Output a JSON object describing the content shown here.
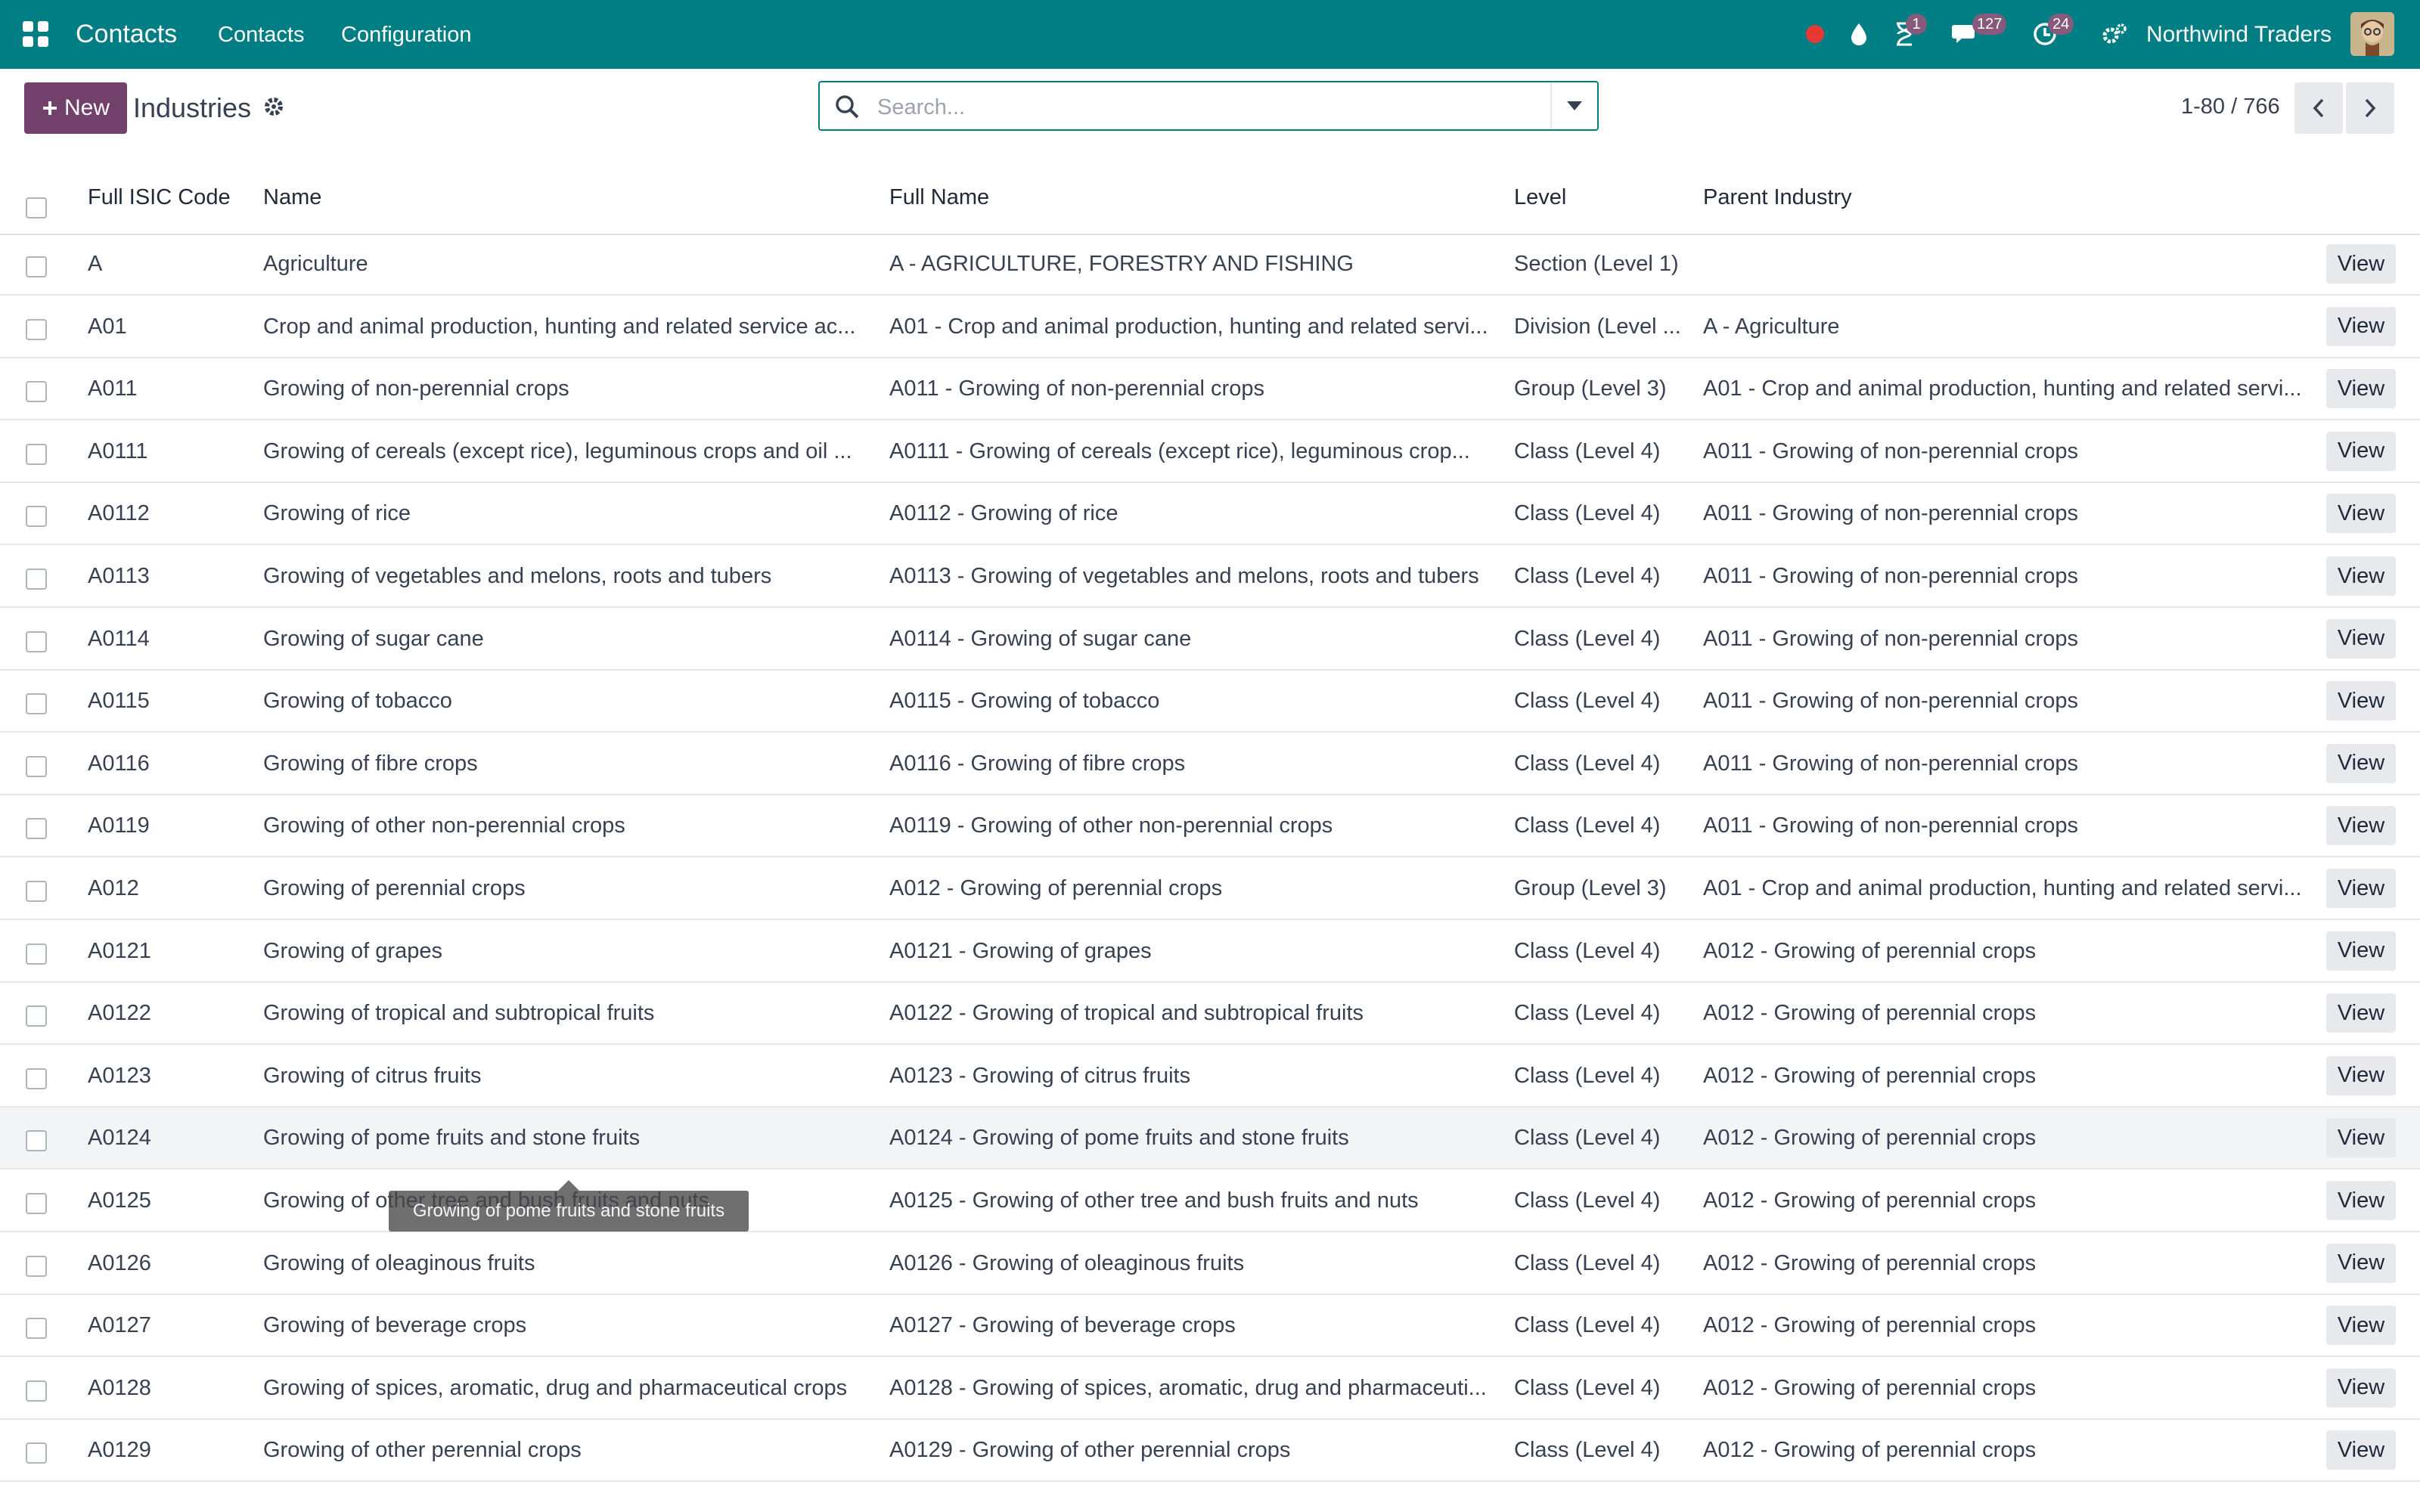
{
  "topbar": {
    "app_name": "Contacts",
    "menu": [
      "Contacts",
      "Configuration"
    ],
    "badges": {
      "activities": "1",
      "messages": "127",
      "clock": "24"
    },
    "company": "Northwind Traders",
    "accent_color": "#017e84"
  },
  "control_panel": {
    "new_label": "New",
    "title": "Industries",
    "search_placeholder": "Search...",
    "pager": "1-80 / 766"
  },
  "table": {
    "columns": [
      "Full ISIC Code",
      "Name",
      "Full Name",
      "Level",
      "Parent Industry"
    ],
    "view_label": "View",
    "rows": [
      {
        "code": "A",
        "name": "Agriculture",
        "full_name": "A - AGRICULTURE, FORESTRY AND FISHING",
        "level": "Section (Level 1)",
        "parent": ""
      },
      {
        "code": "A01",
        "name": "Crop and animal production, hunting and related service ac...",
        "full_name": "A01 - Crop and animal production, hunting and related servi...",
        "level": "Division (Level ...",
        "parent": "A - Agriculture"
      },
      {
        "code": "A011",
        "name": "Growing of non-perennial crops",
        "full_name": "A011 - Growing of non-perennial crops",
        "level": "Group (Level 3)",
        "parent": "A01 - Crop and animal production, hunting and related servi..."
      },
      {
        "code": "A0111",
        "name": "Growing of cereals (except rice), leguminous crops and oil ...",
        "full_name": "A0111 - Growing of cereals (except rice), leguminous crop...",
        "level": "Class (Level 4)",
        "parent": "A011 - Growing of non-perennial crops"
      },
      {
        "code": "A0112",
        "name": "Growing of rice",
        "full_name": "A0112 - Growing of rice",
        "level": "Class (Level 4)",
        "parent": "A011 - Growing of non-perennial crops"
      },
      {
        "code": "A0113",
        "name": "Growing of vegetables and melons, roots and tubers",
        "full_name": "A0113 - Growing of vegetables and melons, roots and tubers",
        "level": "Class (Level 4)",
        "parent": "A011 - Growing of non-perennial crops"
      },
      {
        "code": "A0114",
        "name": "Growing of sugar cane",
        "full_name": "A0114 - Growing of sugar cane",
        "level": "Class (Level 4)",
        "parent": "A011 - Growing of non-perennial crops"
      },
      {
        "code": "A0115",
        "name": "Growing of tobacco",
        "full_name": "A0115 - Growing of tobacco",
        "level": "Class (Level 4)",
        "parent": "A011 - Growing of non-perennial crops"
      },
      {
        "code": "A0116",
        "name": "Growing of fibre crops",
        "full_name": "A0116 - Growing of fibre crops",
        "level": "Class (Level 4)",
        "parent": "A011 - Growing of non-perennial crops"
      },
      {
        "code": "A0119",
        "name": "Growing of other non-perennial crops",
        "full_name": "A0119 - Growing of other non-perennial crops",
        "level": "Class (Level 4)",
        "parent": "A011 - Growing of non-perennial crops"
      },
      {
        "code": "A012",
        "name": "Growing of perennial crops",
        "full_name": "A012 - Growing of perennial crops",
        "level": "Group (Level 3)",
        "parent": "A01 - Crop and animal production, hunting and related servi..."
      },
      {
        "code": "A0121",
        "name": "Growing of grapes",
        "full_name": "A0121 - Growing of grapes",
        "level": "Class (Level 4)",
        "parent": "A012 - Growing of perennial crops"
      },
      {
        "code": "A0122",
        "name": "Growing of tropical and subtropical fruits",
        "full_name": "A0122 - Growing of tropical and subtropical fruits",
        "level": "Class (Level 4)",
        "parent": "A012 - Growing of perennial crops"
      },
      {
        "code": "A0123",
        "name": "Growing of citrus fruits",
        "full_name": "A0123 - Growing of citrus fruits",
        "level": "Class (Level 4)",
        "parent": "A012 - Growing of perennial crops"
      },
      {
        "code": "A0124",
        "name": "Growing of pome fruits and stone fruits",
        "full_name": "A0124 - Growing of pome fruits and stone fruits",
        "level": "Class (Level 4)",
        "parent": "A012 - Growing of perennial crops"
      },
      {
        "code": "A0125",
        "name": "Growing of other tree and bush fruits and nuts",
        "full_name": "A0125 - Growing of other tree and bush fruits and nuts",
        "level": "Class (Level 4)",
        "parent": "A012 - Growing of perennial crops"
      },
      {
        "code": "A0126",
        "name": "Growing of oleaginous fruits",
        "full_name": "A0126 - Growing of oleaginous fruits",
        "level": "Class (Level 4)",
        "parent": "A012 - Growing of perennial crops"
      },
      {
        "code": "A0127",
        "name": "Growing of beverage crops",
        "full_name": "A0127 - Growing of beverage crops",
        "level": "Class (Level 4)",
        "parent": "A012 - Growing of perennial crops"
      },
      {
        "code": "A0128",
        "name": "Growing of spices, aromatic, drug and pharmaceutical crops",
        "full_name": "A0128 - Growing of spices, aromatic, drug and pharmaceuti...",
        "level": "Class (Level 4)",
        "parent": "A012 - Growing of perennial crops"
      },
      {
        "code": "A0129",
        "name": "Growing of other perennial crops",
        "full_name": "A0129 - Growing of other perennial crops",
        "level": "Class (Level 4)",
        "parent": "A012 - Growing of perennial crops"
      }
    ]
  },
  "tooltip": "Growing of pome fruits and stone fruits"
}
